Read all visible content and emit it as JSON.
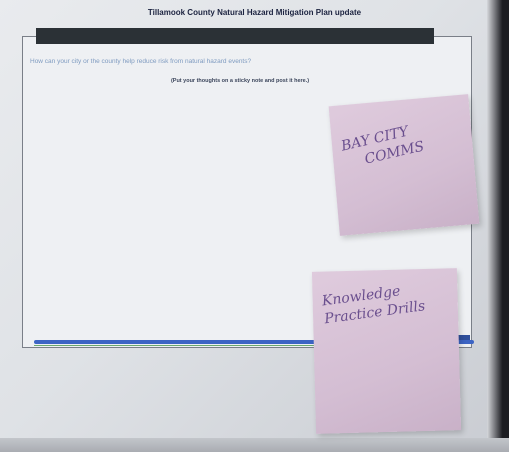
{
  "poster": {
    "title": "Tillamook County Natural Hazard Mitigation Plan update",
    "question": "How can your city or the county help reduce risk from natural hazard events?",
    "instruction": "(Put your thoughts on a sticky note and post it here.)"
  },
  "sticky_notes": [
    {
      "line1": "BAY CITY",
      "line2": "COMMS"
    },
    {
      "line1": "Knowledge",
      "line2": "Practice Drills"
    }
  ],
  "colors": {
    "header_bar": "#2b3136",
    "question_text": "#7f9bc0",
    "sticky_note": "#d8c3d7",
    "handwriting": "#6a4f8e",
    "accent_line": "#3c64c4"
  }
}
